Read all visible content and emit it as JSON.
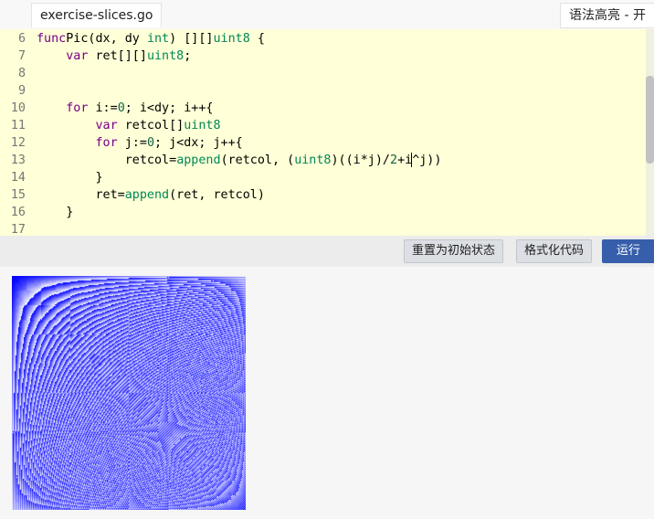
{
  "tab": {
    "filename": "exercise-slices.go"
  },
  "syntax_toggle": {
    "label": "语法高亮 - 开"
  },
  "editor": {
    "lines": [
      {
        "num": "6",
        "parts": [
          [
            "kw",
            "func"
          ],
          [
            "",
            "Pic(dx, dy "
          ],
          [
            "ty",
            "int"
          ],
          [
            "",
            ") [][]"
          ],
          [
            "ty",
            "uint8"
          ],
          [
            "",
            " {"
          ]
        ]
      },
      {
        "num": "7",
        "parts": [
          [
            "",
            "    "
          ],
          [
            "kw",
            "var"
          ],
          [
            "",
            " ret[][]"
          ],
          [
            "ty",
            "uint8"
          ],
          [
            "",
            ";"
          ]
        ]
      },
      {
        "num": "8",
        "parts": []
      },
      {
        "num": "9",
        "parts": []
      },
      {
        "num": "10",
        "parts": [
          [
            "",
            "    "
          ],
          [
            "kw",
            "for"
          ],
          [
            "",
            " i:="
          ],
          [
            "nm",
            "0"
          ],
          [
            "",
            "; i<dy; i++{"
          ]
        ]
      },
      {
        "num": "11",
        "parts": [
          [
            "",
            "        "
          ],
          [
            "kw",
            "var"
          ],
          [
            "",
            " retcol[]"
          ],
          [
            "ty",
            "uint8"
          ]
        ]
      },
      {
        "num": "12",
        "parts": [
          [
            "",
            "        "
          ],
          [
            "kw",
            "for"
          ],
          [
            "",
            " j:="
          ],
          [
            "nm",
            "0"
          ],
          [
            "",
            "; j<dx; j++{"
          ]
        ]
      },
      {
        "num": "13",
        "parts": [
          [
            "",
            "            retcol="
          ],
          [
            "ty",
            "append"
          ],
          [
            "",
            "(retcol, ("
          ],
          [
            "ty",
            "uint8"
          ],
          [
            "",
            ")((i*j)/"
          ],
          [
            "nm",
            "2"
          ],
          [
            "",
            "+i"
          ],
          [
            "cursor",
            ""
          ],
          [
            "",
            "^j))"
          ]
        ]
      },
      {
        "num": "14",
        "parts": [
          [
            "",
            "        }"
          ]
        ]
      },
      {
        "num": "15",
        "parts": [
          [
            "",
            "        ret="
          ],
          [
            "ty",
            "append"
          ],
          [
            "",
            "(ret, retcol)"
          ]
        ]
      },
      {
        "num": "16",
        "parts": [
          [
            "",
            "    }"
          ]
        ]
      },
      {
        "num": "17",
        "parts": []
      }
    ]
  },
  "toolbar": {
    "reset_label": "重置为初始状态",
    "format_label": "格式化代码",
    "run_label": "运行"
  },
  "output": {
    "image": {
      "width": 256,
      "height": 256,
      "color": "#0000ff"
    }
  },
  "colors": {
    "editor_bg": "#ffffd8",
    "keyword": "#770088",
    "type": "#008855",
    "number": "#116644",
    "run_button": "#375eab"
  }
}
